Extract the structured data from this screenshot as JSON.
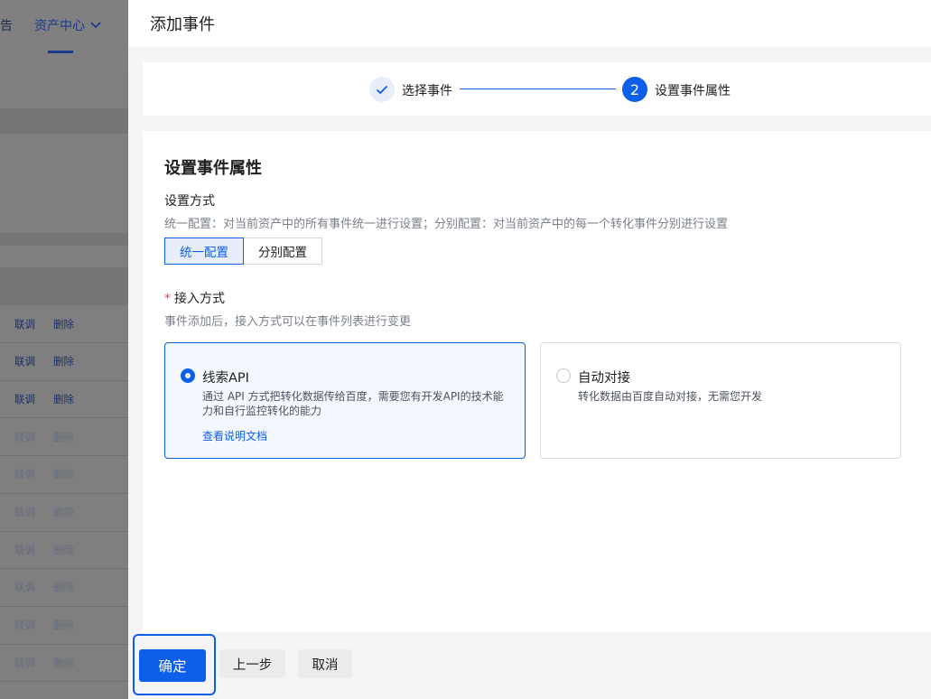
{
  "background": {
    "nav_partial": "告",
    "nav_asset_center": "资产中心",
    "rows": [
      {
        "link": "联调",
        "del": "删除",
        "style": "strong"
      },
      {
        "link": "联调",
        "del": "删除",
        "style": "strong"
      },
      {
        "link": "联调",
        "del": "删除",
        "style": "strong"
      },
      {
        "link": "联调",
        "del": "删除",
        "style": "faded"
      },
      {
        "link": "联调",
        "del": "删除",
        "style": "faded"
      },
      {
        "link": "联调",
        "del": "删除",
        "style": "faded"
      },
      {
        "link": "联调",
        "del": "删除",
        "style": "faded"
      },
      {
        "link": "联调",
        "del": "删除",
        "style": "faded"
      },
      {
        "link": "联调",
        "del": "删除",
        "style": "faded"
      },
      {
        "link": "联调",
        "del": "删除",
        "style": "faded"
      }
    ]
  },
  "drawer": {
    "title": "添加事件",
    "steps": [
      {
        "label": "选择事件",
        "state": "done"
      },
      {
        "label": "设置事件属性",
        "number": "2",
        "state": "active"
      }
    ],
    "section_title": "设置事件属性",
    "setting_mode": {
      "label": "设置方式",
      "hint": "统一配置：对当前资产中的所有事件统一进行设置；分别配置：对当前资产中的每一个转化事件分别进行设置",
      "options": [
        "统一配置",
        "分别配置"
      ],
      "selected": "统一配置"
    },
    "access_mode": {
      "required_mark": "*",
      "label": "接入方式",
      "hint": "事件添加后，接入方式可以在事件列表进行变更",
      "options": [
        {
          "title": "线索API",
          "desc": "通过 API 方式把转化数据传给百度，需要您有开发API的技术能力和自行监控转化的能力",
          "link": "查看说明文档",
          "selected": true
        },
        {
          "title": "自动对接",
          "desc": "转化数据由百度自动对接，无需您开发",
          "selected": false
        }
      ]
    },
    "footer": {
      "confirm": "确定",
      "prev": "上一步",
      "cancel": "取消"
    }
  },
  "colors": {
    "primary": "#0d5ee8",
    "required": "#e54545"
  }
}
